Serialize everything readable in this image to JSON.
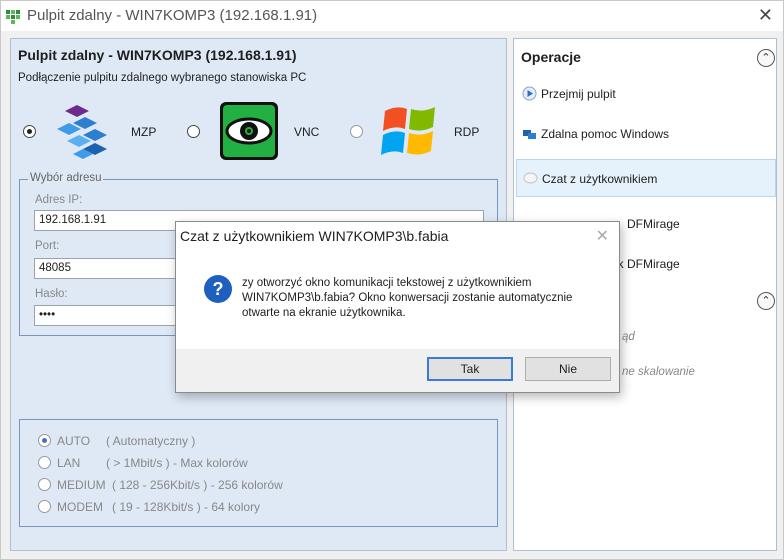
{
  "window": {
    "title": "Pulpit zdalny - WIN7KOMP3 (192.168.1.91)",
    "close_glyph": "✕"
  },
  "left": {
    "title": "Pulpit zdalny - WIN7KOMP3 (192.168.1.91)",
    "subtitle": "Podłączenie pulpitu zdalnego wybranego stanowiska PC",
    "protocols": [
      {
        "label": "MZP",
        "selected": true
      },
      {
        "label": "VNC",
        "selected": false
      },
      {
        "label": "RDP",
        "selected": false
      }
    ],
    "address": {
      "legend": "Wybór adresu",
      "ip_label": "Adres IP:",
      "ip_value": "192.168.1.91",
      "port_label": "Port:",
      "port_value": "48085",
      "password_label": "Hasło:",
      "password_value": "••••"
    },
    "speeds": [
      {
        "name": "AUTO",
        "desc": "( Automatyczny )",
        "selected": true
      },
      {
        "name": "LAN",
        "desc": "( > 1Mbit/s ) - Max kolorów",
        "selected": false
      },
      {
        "name": "MEDIUM",
        "desc": "( 128 - 256Kbit/s ) - 256 kolorów",
        "selected": false
      },
      {
        "name": "MODEM",
        "desc": "( 19 - 128Kbit/s ) - 64 kolory",
        "selected": false
      }
    ]
  },
  "right": {
    "title": "Operacje",
    "collapse_glyph": "⌃",
    "ops": [
      {
        "label": "Przejmij pulpit"
      },
      {
        "label": "Zdalna pomoc Windows"
      },
      {
        "label": "Czat z użytkownikiem"
      },
      {
        "label": "DFMirage"
      },
      {
        "label": "ik DFMirage"
      }
    ],
    "lower_fragments": [
      "ąd",
      "ne skalowanie"
    ]
  },
  "dialog": {
    "title": "Czat z użytkownikiem WIN7KOMP3\\b.fabia",
    "message": "zy otworzyć okno komunikacji tekstowej z użytkownikiem\nWIN7KOMP3\\b.fabia? Okno konwersacji zostanie automatycznie\notwarte na ekranie użytkownika.",
    "yes_label": "Tak",
    "no_label": "Nie",
    "close_glyph": "✕"
  },
  "colors": {
    "panel_bg": "#dfe9f6",
    "accent": "#3a7bd5",
    "selection": "#e5f1fb"
  }
}
